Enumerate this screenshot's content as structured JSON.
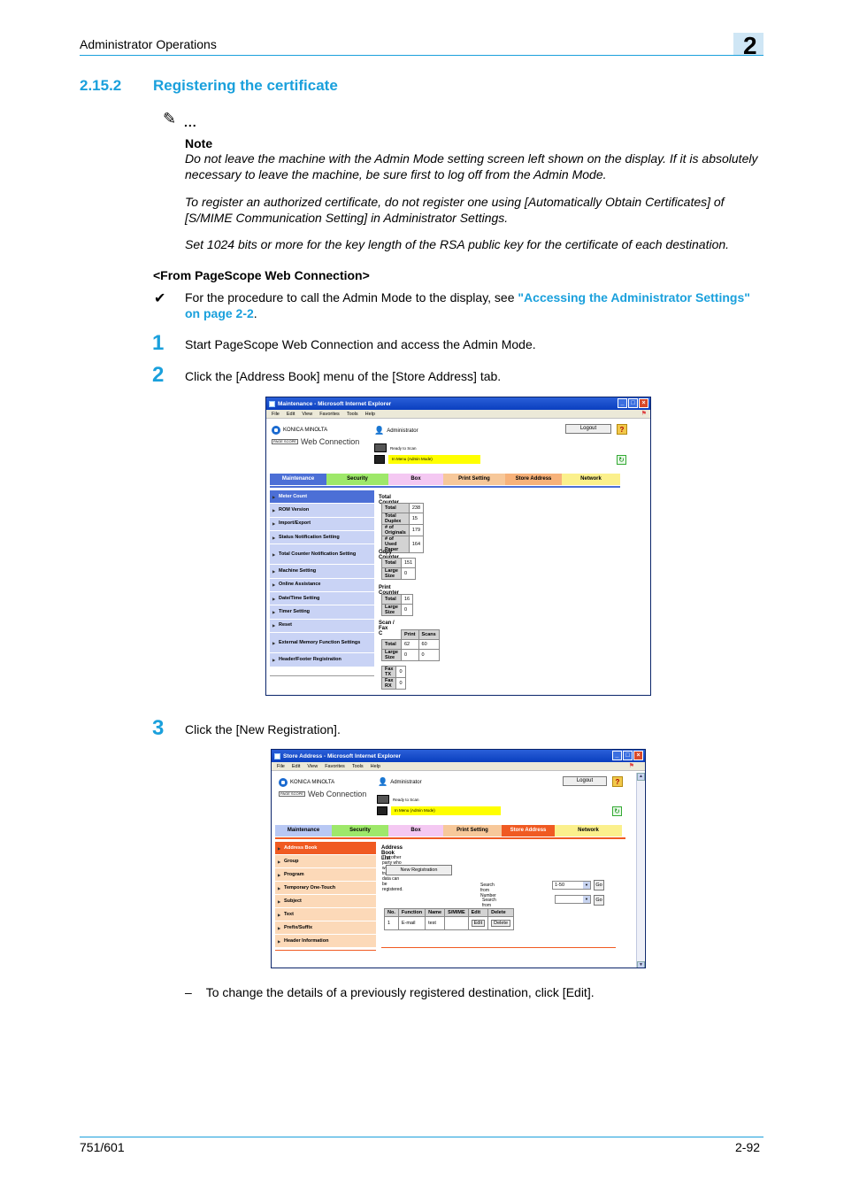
{
  "header": {
    "section_title": "Administrator Operations",
    "chapter_number": "2"
  },
  "section": {
    "number": "2.15.2",
    "title": "Registering the certificate"
  },
  "note": {
    "icon": "pencil-note-icon",
    "dots": "...",
    "label": "Note",
    "paragraphs": [
      "Do not leave the machine with the Admin Mode setting screen left shown on the display. If it is absolutely necessary to leave the machine, be sure first to log off from the Admin Mode.",
      "To register an authorized certificate, do not register one using [Automatically Obtain Certificates] of [S/MIME Communication Setting] in Administrator Settings.",
      "Set 1024 bits or more for the key length of the RSA public key for the certificate of each destination."
    ]
  },
  "subheading": "<From PageScope Web Connection>",
  "prereq": {
    "icon": "checkmark-icon",
    "text_before": "For the procedure to call the Admin Mode to the display, see ",
    "link_line1": "\"Accessing the Administrator Settings\"",
    "link_line2": "on page 2-2",
    "text_after": "."
  },
  "steps": [
    {
      "number": "1",
      "text": "Start PageScope Web Connection and access the Admin Mode."
    },
    {
      "number": "2",
      "text": "Click the [Address Book] menu of the [Store Address] tab."
    },
    {
      "number": "3",
      "text": "Click the [New Registration]."
    }
  ],
  "sub_bullet": {
    "dash": "–",
    "text": "To change the details of a previously registered destination, click [Edit]."
  },
  "screenshot1": {
    "window_title": "Maintenance - Microsoft Internet Explorer",
    "menu": [
      "File",
      "Edit",
      "View",
      "Favorites",
      "Tools",
      "Help"
    ],
    "brand": "KONICA MINOLTA",
    "ps_badge": "PAGE SCOPE",
    "product": "Web Connection",
    "user": "Administrator",
    "logout": "Logout",
    "help": "?",
    "status": "Ready to Scan",
    "mode": "In Menu (Admin Mode)",
    "tabs": [
      {
        "label": "Maintenance",
        "color": "#4c6fd6",
        "text_color": "#ffffff"
      },
      {
        "label": "Security",
        "color": "#9ee86a",
        "text_color": "#000000"
      },
      {
        "label": "Box",
        "color": "#f4c8f2",
        "text_color": "#000000"
      },
      {
        "label": "Print Setting",
        "color": "#f7c89a",
        "text_color": "#000000"
      },
      {
        "label": "Store Address",
        "color": "#f7b27a",
        "text_color": "#000000"
      },
      {
        "label": "Network",
        "color": "#fbf08c",
        "text_color": "#000000"
      }
    ],
    "nav": [
      {
        "label": "Meter Count",
        "active": true
      },
      {
        "label": "ROM Version"
      },
      {
        "label": "Import/Export"
      },
      {
        "label": "Status Notification Setting"
      },
      {
        "label": "Total Counter Notification Setting"
      },
      {
        "label": "Machine Setting"
      },
      {
        "label": "Online Assistance"
      },
      {
        "label": "Date/Time Setting"
      },
      {
        "label": "Timer Setting"
      },
      {
        "label": "Reset"
      },
      {
        "label": "External Memory Function Settings"
      },
      {
        "label": "Header/Footer Registration"
      }
    ],
    "total_counter": {
      "title": "Total Counter",
      "rows": [
        [
          "Total",
          "238"
        ],
        [
          "Total Duplex",
          "15"
        ],
        [
          "# of Originals",
          "179"
        ],
        [
          "# of Used Paper",
          "164"
        ]
      ]
    },
    "copy_counter": {
      "title": "Copy Counter",
      "rows": [
        [
          "Total",
          "151"
        ],
        [
          "Large Size",
          "0"
        ]
      ]
    },
    "print_counter": {
      "title": "Print Counter",
      "rows": [
        [
          "Total",
          "16"
        ],
        [
          "Large Size",
          "0"
        ]
      ]
    },
    "scan_fax_counter": {
      "title": "Scan / Fax Counter",
      "headers": [
        "",
        "Print",
        "Scans"
      ],
      "rows": [
        [
          "Total",
          "62",
          "60"
        ],
        [
          "Large Size",
          "0",
          "0"
        ]
      ],
      "fax_rows": [
        [
          "Fax TX",
          "0"
        ],
        [
          "Fax RX",
          "0"
        ]
      ]
    }
  },
  "screenshot2": {
    "window_title": "Store Address - Microsoft Internet Explorer",
    "menu": [
      "File",
      "Edit",
      "View",
      "Favorites",
      "Tools",
      "Help"
    ],
    "brand": "KONICA MINOLTA",
    "ps_badge": "PAGE SCOPE",
    "product": "Web Connection",
    "user": "Administrator",
    "logout": "Logout",
    "help": "?",
    "status": "Ready to Scan",
    "mode": "In Menu (Admin Mode)",
    "tabs": [
      {
        "label": "Maintenance",
        "color": "#b8c8f4",
        "text_color": "#000000"
      },
      {
        "label": "Security",
        "color": "#9ee86a",
        "text_color": "#000000"
      },
      {
        "label": "Box",
        "color": "#f4c8f2",
        "text_color": "#000000"
      },
      {
        "label": "Print Setting",
        "color": "#f7c89a",
        "text_color": "#000000"
      },
      {
        "label": "Store Address",
        "color": "#f05a22",
        "text_color": "#ffffff"
      },
      {
        "label": "Network",
        "color": "#fbf08c",
        "text_color": "#000000"
      }
    ],
    "nav": [
      {
        "label": "Address Book",
        "active": true
      },
      {
        "label": "Group"
      },
      {
        "label": "Program"
      },
      {
        "label": "Temporary One-Touch"
      },
      {
        "label": "Subject"
      },
      {
        "label": "Text"
      },
      {
        "label": "Prefix/Suffix"
      },
      {
        "label": "Header Information"
      }
    ],
    "list_title": "Address Book List",
    "list_desc": "The other party who wants to transmit data can be registered.",
    "new_registration": "New Registration",
    "search_number_label": "Search from Number",
    "search_number_value": "1-50",
    "search_index_label": "Search from Index",
    "search_index_value": "",
    "go": "Go",
    "table_headers": [
      "No.",
      "Function",
      "Name",
      "S/MIME",
      "Edit",
      "Delete"
    ],
    "table_rows": [
      {
        "no": "1",
        "function": "E-mail",
        "name": "test",
        "smime": "",
        "edit": "Edit",
        "delete": "Delete"
      }
    ]
  },
  "footer": {
    "model": "751/601",
    "page": "2-92"
  }
}
